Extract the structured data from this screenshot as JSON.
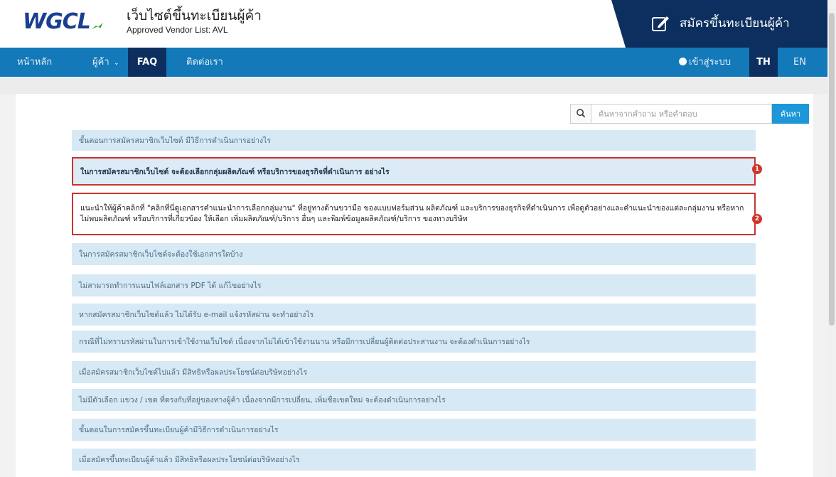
{
  "header": {
    "logo": "WGCL",
    "site_title": "เว็บไซต์ขึ้นทะเบียนผู้ค้า",
    "site_subtitle": "Approved Vendor List: AVL",
    "register_label": "สมัครขึ้นทะเบียนผู้ค้า"
  },
  "nav": {
    "home": "หน้าหลัก",
    "vendor": "ผู้ค้า",
    "faq": "FAQ",
    "contact": "ติดต่อเรา",
    "login": "เข้าสู่ระบบ",
    "lang_th": "TH",
    "lang_en": "EN"
  },
  "search": {
    "placeholder": "ค้นหาจากคำถาม หรือคำตอบ",
    "button": "ค้นหา"
  },
  "faqs": [
    "ขั้นตอนการสมัครสมาชิกเว็บไซต์ มีวิธีการดำเนินการอย่างไร",
    "ในการสมัครสมาชิกเว็บไซต์ จะต้องเลือกกลุ่มผลิตภัณฑ์ หรือบริการของธุรกิจที่ดำเนินการ อย่างไร",
    "แนะนำให้ผู้ค้าคลิกที่ \"คลิกที่นี่ดูเอกสารคำแนะนำการเลือกกลุ่มงาน\" ที่อยู่ทางด้านขวามือ ของแบบฟอร์มส่วน ผลิตภัณฑ์ และบริการของธุรกิจที่ดำเนินการ เพื่อดูตัวอย่างและคำแนะนำของแต่ละกลุ่มงาน หรือหาก ไม่พบผลิตภัณฑ์ หรือบริการที่เกี่ยวข้อง ให้เลือก เพิ่มผลิตภัณฑ์/บริการ อื่นๆ และพิมพ์ข้อมูลผลิตภัณฑ์/บริการ ของทางบริษัท",
    "ในการสมัครสมาชิกเว็บไซต์จะต้องใช้เอกสารใดบ้าง",
    "ไม่สามารถทำการแนบไฟล์เอกสาร PDF ได้ แก้ไขอย่างไร",
    "หากสมัครสมาชิกเว็บไซต์แล้ว ไม่ได้รับ e-mail แจ้งรหัสผ่าน จะทำอย่างไร",
    "กรณีที่ไม่ทราบรหัสผ่านในการเข้าใช้งานเว็บไซต์ เนื่องจากไม่ได้เข้าใช้งานนาน หรือมีการเปลี่ยนผู้ติดต่อประสานงาน จะต้องดำเนินการอย่างไร",
    "เมื่อสมัครสมาชิกเว็บไซต์ไปแล้ว มีสิทธิหรือผลประโยชน์ต่อบริษัทอย่างไร",
    "ไม่มีตัวเลือก แขวง / เขต ที่ตรงกับที่อยู่ของทางผู้ค้า เนื่องจากมีการเปลี่ยน, เพิ่มชื่อเขตใหม่ จะต้องดำเนินการอย่างไร",
    "ขั้นตอนในการสมัครขึ้นทะเบียนผู้ค้ามีวิธีการดำเนินการอย่างไร",
    "เมื่อสมัครขึ้นทะเบียนผู้ค้าแล้ว มีสิทธิหรือผลประโยชน์ต่อบริษัทอย่างไร"
  ],
  "markers": [
    "1",
    "2"
  ],
  "colors": {
    "nav": "#1379b8",
    "dark_navy": "#0d2f5f",
    "faq_bg": "#d6e9f4",
    "highlight": "#c9342f",
    "search_button": "#1d97d8"
  }
}
